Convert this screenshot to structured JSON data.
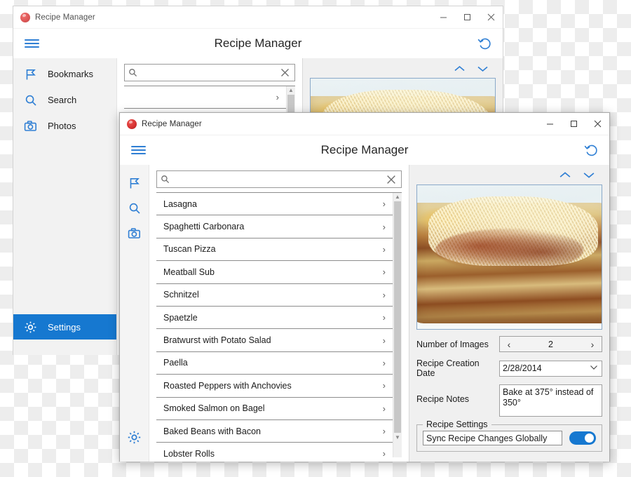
{
  "window_back": {
    "titlebar": {
      "title": "Recipe Manager",
      "app_icon": "recipe-app-icon",
      "minimize": "–",
      "maximize": "□",
      "close": "✕"
    },
    "header": {
      "title": "Recipe Manager",
      "menu_icon": "hamburger-icon",
      "refresh_icon": "refresh-icon"
    },
    "nav": {
      "items": [
        {
          "label": "Bookmarks",
          "icon": "flag-icon"
        },
        {
          "label": "Search",
          "icon": "search-icon"
        },
        {
          "label": "Photos",
          "icon": "camera-icon"
        }
      ],
      "selected": {
        "label": "Settings",
        "icon": "gear-icon"
      }
    },
    "search": {
      "value": "",
      "placeholder": "",
      "search_icon": "search-icon",
      "clear_icon": "clear-icon"
    },
    "list": {
      "rows": [
        "",
        ""
      ],
      "chevron": "›"
    },
    "detail": {
      "up_icon": "chevron-up-icon",
      "down_icon": "chevron-down-icon",
      "photo": "lasagna-photo"
    }
  },
  "window_front": {
    "titlebar": {
      "title": "Recipe Manager",
      "app_icon": "recipe-app-icon",
      "minimize": "–",
      "maximize": "□",
      "close": "✕"
    },
    "header": {
      "title": "Recipe Manager",
      "menu_icon": "hamburger-icon",
      "refresh_icon": "refresh-icon"
    },
    "rail": {
      "items": [
        {
          "icon": "flag-icon",
          "name": "bookmarks"
        },
        {
          "icon": "search-icon",
          "name": "search"
        },
        {
          "icon": "camera-icon",
          "name": "photos"
        }
      ],
      "bottom": {
        "icon": "gear-icon",
        "name": "settings"
      }
    },
    "search": {
      "value": "",
      "placeholder": "",
      "search_icon": "search-icon",
      "clear_icon": "clear-icon"
    },
    "list": {
      "chevron": "›",
      "items": [
        "Lasagna",
        "Spaghetti Carbonara",
        "Tuscan Pizza",
        "Meatball Sub",
        "Schnitzel",
        "Spaetzle",
        "Bratwurst with Potato Salad",
        "Paella",
        "Roasted Peppers with Anchovies",
        "Smoked Salmon on Bagel",
        "Baked Beans with Bacon",
        "Lobster Rolls"
      ],
      "scroll_up": "▲",
      "scroll_down": "▼"
    },
    "detail": {
      "up_icon": "chevron-up-icon",
      "down_icon": "chevron-down-icon",
      "photo": "lasagna-photo",
      "fields": {
        "number_of_images": {
          "label": "Number of Images",
          "value": "2",
          "prev": "‹",
          "next": "›"
        },
        "creation_date": {
          "label": "Recipe Creation Date",
          "value": "2/28/2014",
          "arrow": "⌄"
        },
        "notes": {
          "label": "Recipe Notes",
          "value": "Bake at 375° instead of 350°"
        }
      },
      "settings_group": {
        "title": "Recipe Settings",
        "sync_label": "Sync Recipe Changes Globally",
        "toggle_on": true
      }
    }
  },
  "colors": {
    "accent": "#1678d0",
    "icon_blue": "#2f7fd4",
    "nav_bg": "#f2f2f2",
    "detail_bg": "#f0f0f0"
  }
}
